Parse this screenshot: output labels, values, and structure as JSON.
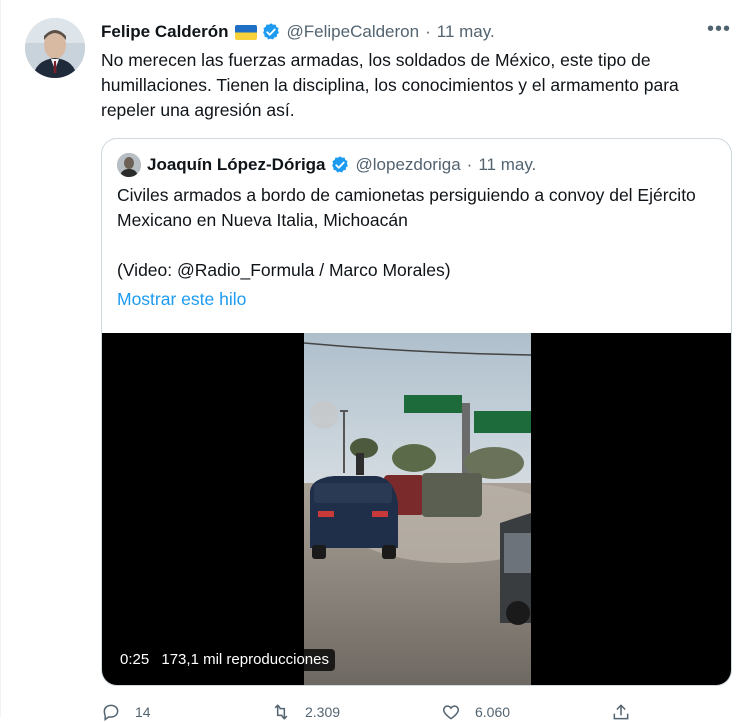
{
  "tweet": {
    "author_name": "Felipe Calderón",
    "author_handle": "@FelipeCalderon",
    "separator": "·",
    "date": "11 may.",
    "more_label": "•••",
    "text": "No merecen las fuerzas armadas, los soldados de México, este tipo de humillaciones. Tienen la disciplina, los conocimientos y el armamento para repeler una agresión así.",
    "flag": "ukraine-flag",
    "verified": true
  },
  "quote": {
    "author_name": "Joaquín López-Dóriga",
    "author_handle": "@lopezdoriga",
    "separator": "·",
    "date": "11 may.",
    "verified": true,
    "text_line1": "Civiles armados a bordo de camionetas persiguiendo a convoy del Ejército Mexicano en Nueva Italia, Michoacán",
    "text_line2": "(Video: @Radio_Formula / Marco Morales)",
    "show_thread": "Mostrar este hilo",
    "video": {
      "time": "0:25",
      "views": "173,1 mil reproducciones"
    }
  },
  "actions": {
    "replies": "14",
    "retweets": "2.309",
    "likes": "6.060"
  },
  "colors": {
    "link": "#1d9bf0",
    "secondary_text": "#536471",
    "border": "#cfd9de",
    "verified": "#1d9bf0"
  }
}
